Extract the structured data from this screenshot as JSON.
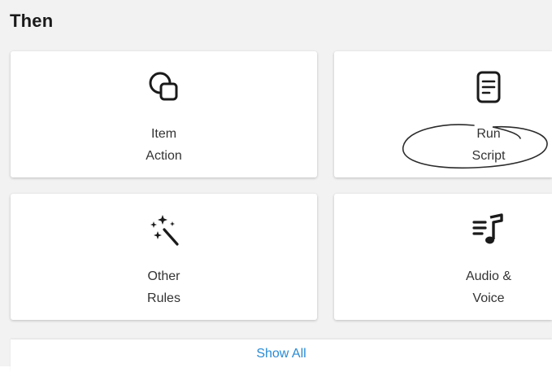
{
  "section": {
    "title": "Then"
  },
  "cards": [
    {
      "icon": "item-action-icon",
      "line1": "Item",
      "line2": "Action"
    },
    {
      "icon": "script-document-icon",
      "line1": "Run",
      "line2": "Script"
    },
    {
      "icon": "magic-wand-sparkles-icon",
      "line1": "Other",
      "line2": "Rules"
    },
    {
      "icon": "music-note-list-icon",
      "line1": "Audio &",
      "line2": "Voice"
    }
  ],
  "footer": {
    "show_all_label": "Show All"
  },
  "colors": {
    "panel_background": "#f2f2f2",
    "card_background": "#ffffff",
    "text": "#333333",
    "link": "#2a8ad4",
    "icon": "#1a1a1a"
  }
}
